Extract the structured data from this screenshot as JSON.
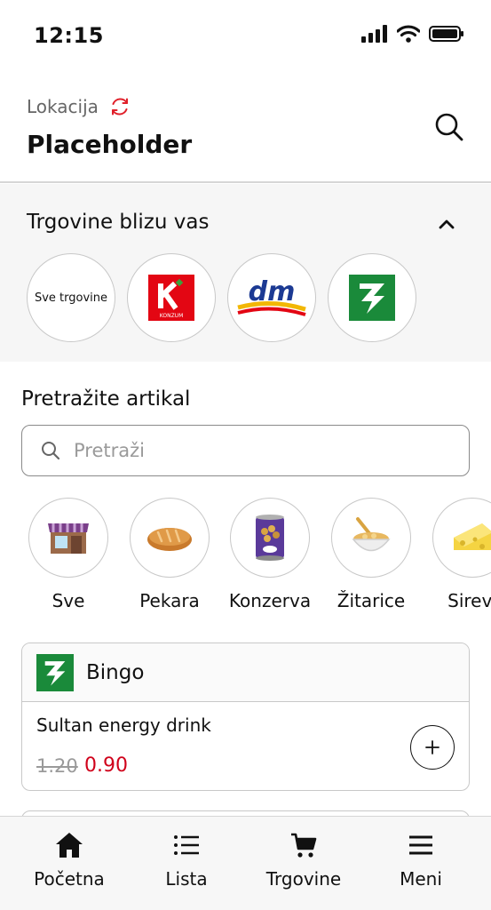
{
  "status": {
    "time": "12:15"
  },
  "header": {
    "location_label": "Lokacija",
    "location_name": "Placeholder"
  },
  "stores": {
    "title": "Trgovine blizu vas",
    "items": [
      {
        "label": "Sve trgovine"
      },
      {
        "label": "Konzum",
        "logo_text": "KONZUM"
      },
      {
        "label": "dm",
        "logo_text": "dm"
      },
      {
        "label": "Bingo"
      }
    ]
  },
  "search": {
    "title": "Pretražite artikal",
    "placeholder": "Pretraži"
  },
  "categories": [
    {
      "label": "Sve",
      "icon": "store-icon"
    },
    {
      "label": "Pekara",
      "icon": "bread-icon"
    },
    {
      "label": "Konzerva",
      "icon": "can-icon"
    },
    {
      "label": "Žitarice",
      "icon": "cereal-icon"
    },
    {
      "label": "Sirevi",
      "icon": "cheese-icon"
    }
  ],
  "deal": {
    "store": "Bingo",
    "product": "Sultan energy drink",
    "old_price": "1.20",
    "new_price": "0.90"
  },
  "tabs": [
    {
      "label": "Početna",
      "icon": "home-icon"
    },
    {
      "label": "Lista",
      "icon": "list-icon"
    },
    {
      "label": "Trgovine",
      "icon": "cart-icon"
    },
    {
      "label": "Meni",
      "icon": "menu-icon"
    }
  ],
  "colors": {
    "accent_red": "#d0021b",
    "bingo_green": "#1a8a3a",
    "konzum_red": "#e30613",
    "dm_blue": "#1c3a93"
  }
}
